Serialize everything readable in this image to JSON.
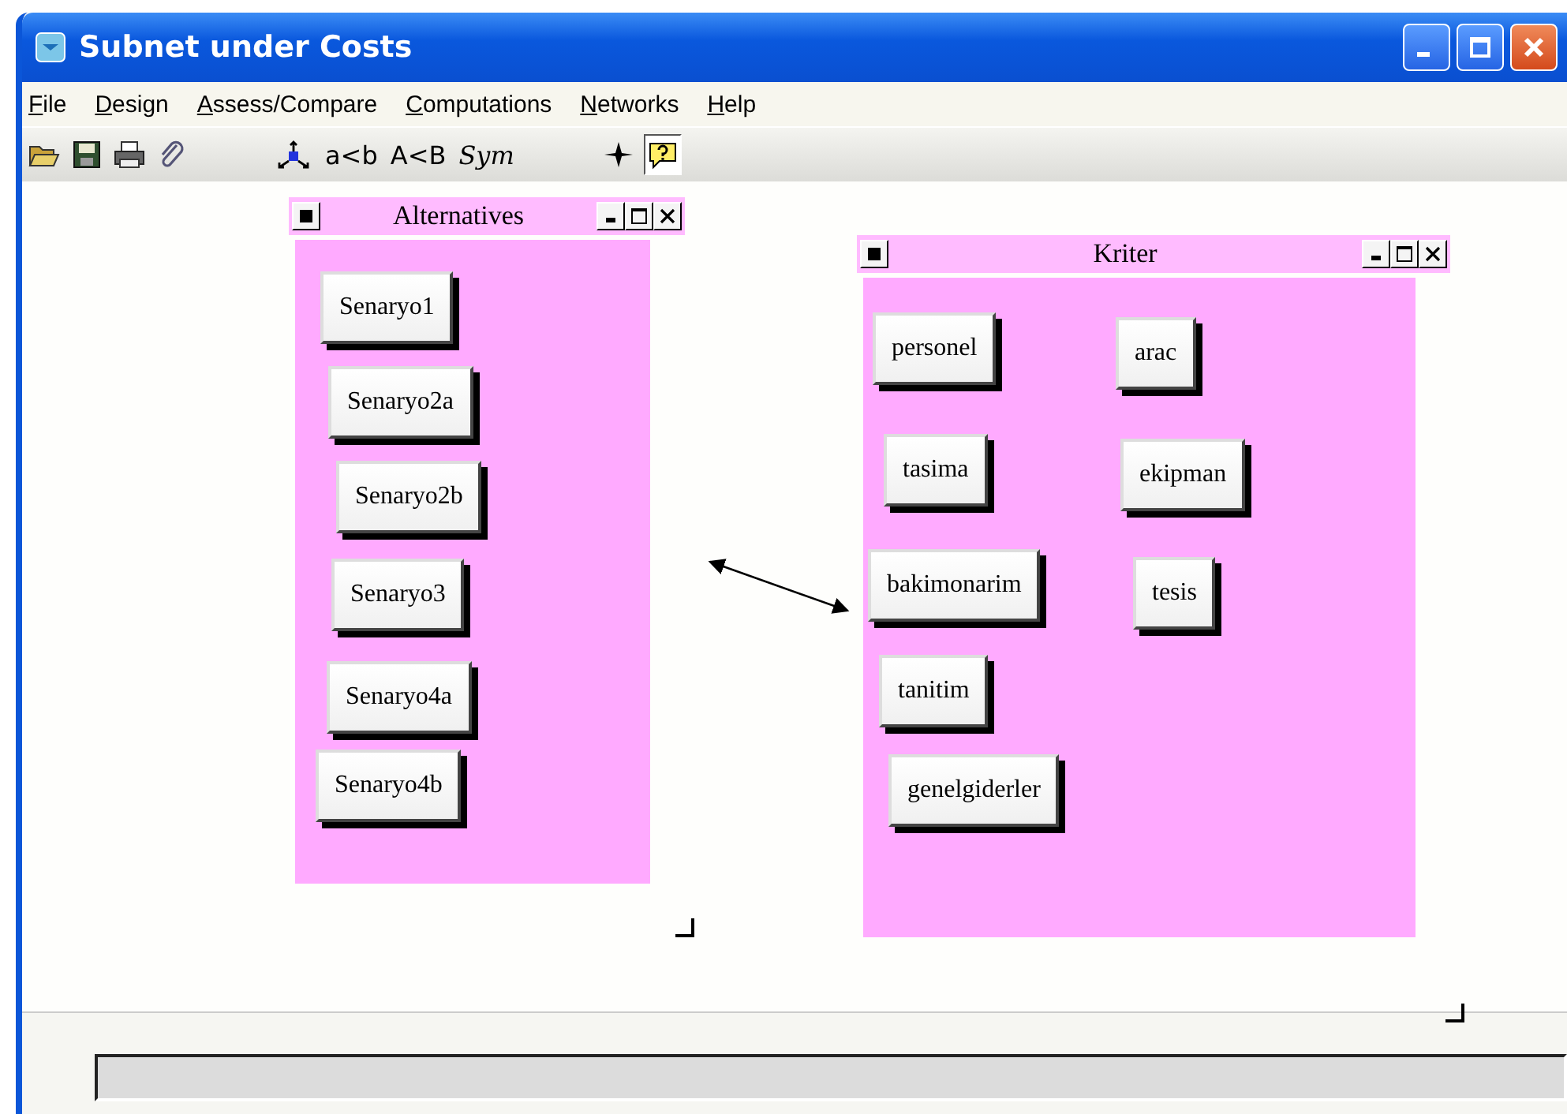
{
  "window": {
    "title": "Subnet under Costs"
  },
  "menu": [
    "File",
    "Design",
    "Assess/Compare",
    "Computations",
    "Networks",
    "Help"
  ],
  "toolbar": [
    {
      "kind": "open",
      "pressed": false
    },
    {
      "kind": "save",
      "pressed": false
    },
    {
      "kind": "print",
      "pressed": false
    },
    {
      "kind": "clip",
      "pressed": false
    },
    {
      "kind": "node",
      "pressed": false
    },
    {
      "kind": "text",
      "label": "a<b",
      "pressed": false
    },
    {
      "kind": "text",
      "label": "A<B",
      "pressed": false
    },
    {
      "kind": "text",
      "label": "Sym",
      "pressed": false
    },
    {
      "kind": "move",
      "pressed": false
    },
    {
      "kind": "help",
      "pressed": true
    }
  ],
  "clusters": [
    {
      "title": "Alternatives",
      "nodes": [
        {
          "label": "Senaryo1"
        },
        {
          "label": "Senaryo2a"
        },
        {
          "label": "Senaryo2b"
        },
        {
          "label": "Senaryo3"
        },
        {
          "label": "Senaryo4a"
        },
        {
          "label": "Senaryo4b"
        }
      ]
    },
    {
      "title": "Kriter",
      "nodes": [
        {
          "label": "personel"
        },
        {
          "label": "arac"
        },
        {
          "label": "tasima"
        },
        {
          "label": "ekipman"
        },
        {
          "label": "bakimonarim"
        },
        {
          "label": "tesis"
        },
        {
          "label": "tanitim"
        },
        {
          "label": "genelgiderler"
        }
      ]
    }
  ]
}
